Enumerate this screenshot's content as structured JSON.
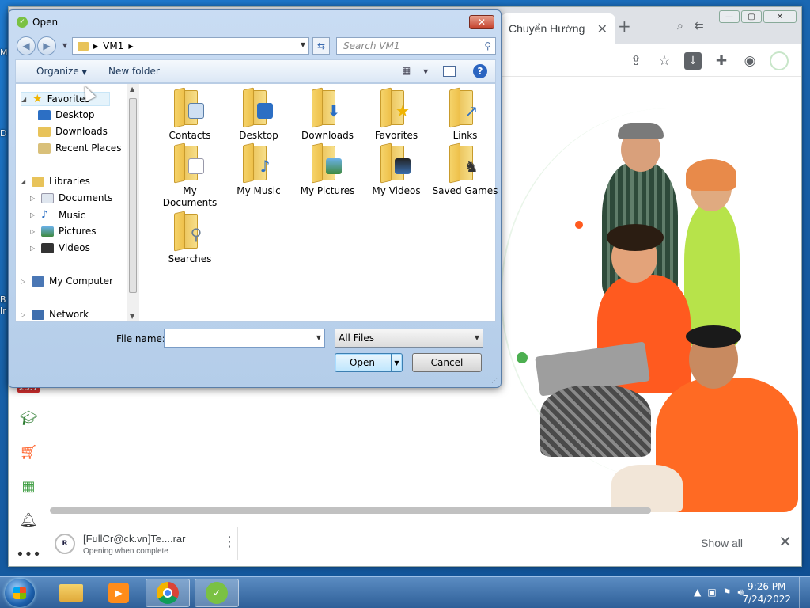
{
  "dialog": {
    "title": "Open",
    "address": {
      "segment": "VM1",
      "chevron": "▶"
    },
    "search_placeholder": "Search VM1",
    "toolbar": {
      "organize": "Organize",
      "new_folder": "New folder"
    },
    "nav": {
      "favorites": "Favorites",
      "desktop": "Desktop",
      "downloads": "Downloads",
      "recent_places": "Recent Places",
      "libraries": "Libraries",
      "documents": "Documents",
      "music": "Music",
      "pictures": "Pictures",
      "videos": "Videos",
      "my_computer": "My Computer",
      "network": "Network"
    },
    "files": [
      {
        "label": "Contacts",
        "emblem": "contact-card"
      },
      {
        "label": "Desktop",
        "emblem": "monitor"
      },
      {
        "label": "Downloads",
        "emblem": "down-arrow"
      },
      {
        "label": "Favorites",
        "emblem": "star"
      },
      {
        "label": "Links",
        "emblem": "link-arrow"
      },
      {
        "label": "My Documents",
        "emblem": "document"
      },
      {
        "label": "My Music",
        "emblem": "music-note"
      },
      {
        "label": "My Pictures",
        "emblem": "picture"
      },
      {
        "label": "My Videos",
        "emblem": "film"
      },
      {
        "label": "Saved Games",
        "emblem": "chess-piece"
      },
      {
        "label": "Searches",
        "emblem": "magnifier"
      }
    ],
    "file_name_label": "File name:",
    "file_name_value": "",
    "file_type": "All Files",
    "open_button": "Open",
    "cancel_button": "Cancel"
  },
  "browser": {
    "tab_title": "Chuyển Hướng",
    "download": {
      "file_name": "[FullCr@ck.vn]Te....rar",
      "status": "Opening when complete",
      "icon_text": "R"
    },
    "show_all": "Show all",
    "sidebar_badge": "25.7"
  },
  "taskbar": {
    "time": "9:26 PM",
    "date": "7/24/2022"
  },
  "desktop_edge_letters": [
    "M",
    "D",
    "B",
    "Ir"
  ],
  "colors": {
    "desktop_blue": "#1b6db8",
    "dialog_frame": "#c9dcf3",
    "accent_orange": "#ff5a1f",
    "accent_green": "#4caf50"
  }
}
